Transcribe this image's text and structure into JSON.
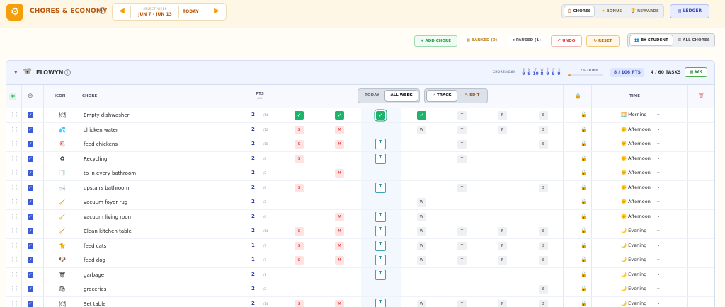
{
  "header": {
    "app_title": "CHORES & ECONOMY",
    "week_label": "SELECT WEEK",
    "week_range": "JUN 7 - JUN 13",
    "today_label": "TODAY",
    "tabs": [
      {
        "label": "CHORES",
        "icon": "clipboard-icon",
        "active": true
      },
      {
        "label": "BONUS",
        "icon": "star-icon",
        "active": false
      },
      {
        "label": "REWARDS",
        "icon": "trophy-icon",
        "active": false
      }
    ],
    "ledger_label": "LEDGER"
  },
  "actions": {
    "add_chore": "+ ADD CHORE",
    "banked": "BANKED (0)",
    "paused": "PAUSED (1)",
    "undo": "UNDO",
    "reset": "RESET",
    "by_student": "BY STUDENT",
    "all_chores": "ALL CHORES"
  },
  "student": {
    "name": "ELOWYN",
    "chores_day_label": "CHORES/DAY",
    "chores_per_day": [
      {
        "day": "S",
        "count": "9"
      },
      {
        "day": "M",
        "count": "9"
      },
      {
        "day": "T",
        "count": "10"
      },
      {
        "day": "W",
        "count": "8"
      },
      {
        "day": "T",
        "count": "9"
      },
      {
        "day": "F",
        "count": "9"
      },
      {
        "day": "S",
        "count": "9"
      }
    ],
    "done_label": "7% DONE",
    "done_fraction": 0.07,
    "points": "8 / 106 PTS",
    "tasks": "4 / 60 TASKS",
    "wk_label": "WK"
  },
  "grid_header": {
    "icon": "ICON",
    "chore": "CHORE",
    "pts": "PTS",
    "pts_sub": "/WK",
    "today_btn": "TODAY",
    "all_week_btn": "ALL WEEK",
    "track_btn": "✓ TRACK",
    "edit_btn": "✎ EDIT",
    "time": "TIME"
  },
  "chores": [
    {
      "icon": "🍽",
      "name": "Empty dishwasher",
      "pts": "2",
      "max": "/14",
      "time_icon": "🌅",
      "time": "Morning",
      "days": [
        [
          "done",
          "✓"
        ],
        [
          "done",
          "✓"
        ],
        [
          "done-outline",
          "✓"
        ],
        [
          "done",
          "✓"
        ],
        [
          "pend",
          "T"
        ],
        [
          "pend",
          "F"
        ],
        [
          "pend",
          "S"
        ]
      ]
    },
    {
      "icon": "💦",
      "name": "chicken water",
      "pts": "2",
      "max": "/12",
      "time_icon": "🌞",
      "time": "Afternoon",
      "days": [
        [
          "miss",
          "S"
        ],
        [
          "miss",
          "M"
        ],
        [
          "none",
          ""
        ],
        [
          "pend",
          "W"
        ],
        [
          "pend",
          "T"
        ],
        [
          "pend",
          "F"
        ],
        [
          "pend",
          "S"
        ]
      ]
    },
    {
      "icon": "🐔",
      "name": "feed chickens",
      "pts": "2",
      "max": "/10",
      "time_icon": "🌞",
      "time": "Afternoon",
      "days": [
        [
          "miss",
          "S"
        ],
        [
          "miss",
          "M"
        ],
        [
          "today",
          "T"
        ],
        [
          "none",
          ""
        ],
        [
          "pend",
          "T"
        ],
        [
          "none",
          ""
        ],
        [
          "pend",
          "S"
        ]
      ]
    },
    {
      "icon": "♻",
      "name": "Recycling",
      "pts": "2",
      "max": "/6",
      "time_icon": "🌞",
      "time": "Afternoon",
      "days": [
        [
          "miss",
          "S"
        ],
        [
          "none",
          ""
        ],
        [
          "today",
          "T"
        ],
        [
          "none",
          ""
        ],
        [
          "pend",
          "T"
        ],
        [
          "none",
          ""
        ],
        [
          "none",
          ""
        ]
      ]
    },
    {
      "icon": "🧻",
      "name": "tp in every bathroom",
      "pts": "2",
      "max": "/2",
      "time_icon": "🌞",
      "time": "Afternoon",
      "days": [
        [
          "none",
          ""
        ],
        [
          "miss",
          "M"
        ],
        [
          "none",
          ""
        ],
        [
          "none",
          ""
        ],
        [
          "none",
          ""
        ],
        [
          "none",
          ""
        ],
        [
          "none",
          ""
        ]
      ]
    },
    {
      "icon": "🛁",
      "name": "upstairs bathroom",
      "pts": "2",
      "max": "/6",
      "time_icon": "🌞",
      "time": "Afternoon",
      "days": [
        [
          "miss",
          "S"
        ],
        [
          "none",
          ""
        ],
        [
          "today",
          "T"
        ],
        [
          "none",
          ""
        ],
        [
          "pend",
          "T"
        ],
        [
          "none",
          ""
        ],
        [
          "pend",
          "S"
        ]
      ]
    },
    {
      "icon": "🧹",
      "name": "vacuum foyer rug",
      "pts": "2",
      "max": "/2",
      "time_icon": "🌞",
      "time": "Afternoon",
      "days": [
        [
          "none",
          ""
        ],
        [
          "none",
          ""
        ],
        [
          "none",
          ""
        ],
        [
          "pend",
          "W"
        ],
        [
          "none",
          ""
        ],
        [
          "none",
          ""
        ],
        [
          "none",
          ""
        ]
      ]
    },
    {
      "icon": "🧹",
      "name": "vacuum living room",
      "pts": "2",
      "max": "/6",
      "time_icon": "🌞",
      "time": "Afternoon",
      "days": [
        [
          "none",
          ""
        ],
        [
          "miss",
          "M"
        ],
        [
          "today",
          "T"
        ],
        [
          "pend",
          "W"
        ],
        [
          "none",
          ""
        ],
        [
          "none",
          ""
        ],
        [
          "none",
          ""
        ]
      ]
    },
    {
      "icon": "🧹",
      "name": "Clean kitchen table",
      "pts": "2",
      "max": "/14",
      "time_icon": "🌙",
      "time": "Evening",
      "days": [
        [
          "miss",
          "S"
        ],
        [
          "miss",
          "M"
        ],
        [
          "today",
          "T"
        ],
        [
          "pend",
          "W"
        ],
        [
          "pend",
          "T"
        ],
        [
          "pend",
          "F"
        ],
        [
          "pend",
          "S"
        ]
      ]
    },
    {
      "icon": "🐈",
      "name": "feed cats",
      "pts": "1",
      "max": "/7",
      "time_icon": "🌙",
      "time": "Evening",
      "days": [
        [
          "miss",
          "S"
        ],
        [
          "miss",
          "M"
        ],
        [
          "today",
          "T"
        ],
        [
          "pend",
          "W"
        ],
        [
          "pend",
          "T"
        ],
        [
          "pend",
          "F"
        ],
        [
          "pend",
          "S"
        ]
      ]
    },
    {
      "icon": "🐶",
      "name": "feed dog",
      "pts": "1",
      "max": "/7",
      "time_icon": "🌙",
      "time": "Evening",
      "days": [
        [
          "miss",
          "S"
        ],
        [
          "miss",
          "M"
        ],
        [
          "today",
          "T"
        ],
        [
          "pend",
          "W"
        ],
        [
          "pend",
          "T"
        ],
        [
          "pend",
          "F"
        ],
        [
          "pend",
          "S"
        ]
      ]
    },
    {
      "icon": "🗑",
      "name": "garbage",
      "pts": "2",
      "max": "/1",
      "time_icon": "🌙",
      "time": "Evening",
      "days": [
        [
          "none",
          ""
        ],
        [
          "none",
          ""
        ],
        [
          "today",
          "T"
        ],
        [
          "none",
          ""
        ],
        [
          "none",
          ""
        ],
        [
          "none",
          ""
        ],
        [
          "none",
          ""
        ]
      ]
    },
    {
      "icon": "🛍",
      "name": "groceries",
      "pts": "2",
      "max": "/2",
      "time_icon": "🌙",
      "time": "Evening",
      "days": [
        [
          "none",
          ""
        ],
        [
          "none",
          ""
        ],
        [
          "none",
          ""
        ],
        [
          "none",
          ""
        ],
        [
          "none",
          ""
        ],
        [
          "none",
          ""
        ],
        [
          "pend",
          "S"
        ]
      ]
    },
    {
      "icon": "🍽",
      "name": "Set table",
      "pts": "2",
      "max": "/14",
      "time_icon": "🌙",
      "time": "Evening",
      "days": [
        [
          "miss",
          "S"
        ],
        [
          "miss",
          "M"
        ],
        [
          "today",
          "T"
        ],
        [
          "pend",
          "W"
        ],
        [
          "pend",
          "T"
        ],
        [
          "pend",
          "F"
        ],
        [
          "pend",
          "S"
        ]
      ]
    }
  ]
}
